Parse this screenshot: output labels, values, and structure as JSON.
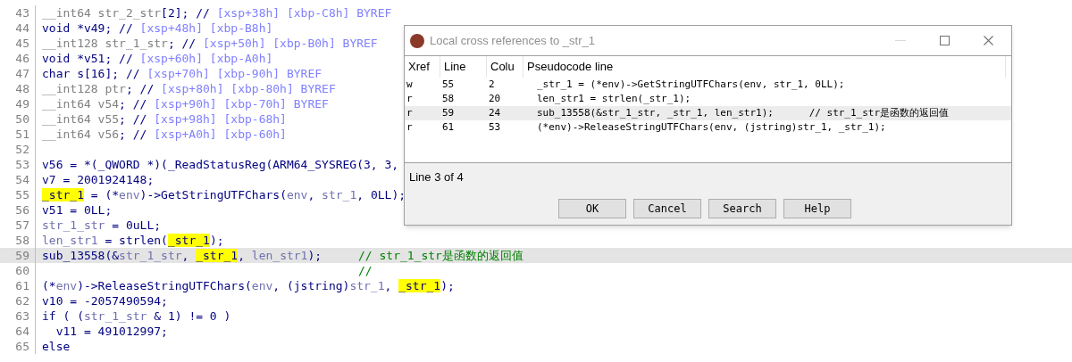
{
  "code_lines": [
    {
      "number": "43",
      "selected": false,
      "segments": [
        {
          "kind": "dim",
          "text": "__int64 str_2_str"
        },
        {
          "kind": "code",
          "text": "[2]; // "
        },
        {
          "kind": "cmt",
          "text": "[xsp+38h] [xbp-C8h] BYREF"
        }
      ]
    },
    {
      "number": "44",
      "selected": false,
      "segments": [
        {
          "kind": "code",
          "text": "void *v49; // "
        },
        {
          "kind": "cmt",
          "text": "[xsp+48h] [xbp-B8h]"
        }
      ]
    },
    {
      "number": "45",
      "selected": false,
      "segments": [
        {
          "kind": "dim",
          "text": "__int128 str_1_str"
        },
        {
          "kind": "code",
          "text": "; // "
        },
        {
          "kind": "cmt",
          "text": "[xsp+50h] [xbp-B0h] BYREF"
        }
      ]
    },
    {
      "number": "46",
      "selected": false,
      "segments": [
        {
          "kind": "code",
          "text": "void *v51; // "
        },
        {
          "kind": "cmt",
          "text": "[xsp+60h] [xbp-A0h]"
        }
      ]
    },
    {
      "number": "47",
      "selected": false,
      "segments": [
        {
          "kind": "code",
          "text": "char s[16]; // "
        },
        {
          "kind": "cmt",
          "text": "[xsp+70h] [xbp-90h] BYREF"
        }
      ]
    },
    {
      "number": "48",
      "selected": false,
      "segments": [
        {
          "kind": "dim",
          "text": "__int128 ptr"
        },
        {
          "kind": "code",
          "text": "; // "
        },
        {
          "kind": "cmt",
          "text": "[xsp+80h] [xbp-80h] BYREF"
        }
      ]
    },
    {
      "number": "49",
      "selected": false,
      "segments": [
        {
          "kind": "dim",
          "text": "__int64 v54"
        },
        {
          "kind": "code",
          "text": "; // "
        },
        {
          "kind": "cmt",
          "text": "[xsp+90h] [xbp-70h] BYREF"
        }
      ]
    },
    {
      "number": "50",
      "selected": false,
      "segments": [
        {
          "kind": "dim",
          "text": "__int64 v55"
        },
        {
          "kind": "code",
          "text": "; // "
        },
        {
          "kind": "cmt",
          "text": "[xsp+98h] [xbp-68h]"
        }
      ]
    },
    {
      "number": "51",
      "selected": false,
      "segments": [
        {
          "kind": "dim",
          "text": "__int64 v56"
        },
        {
          "kind": "code",
          "text": "; // "
        },
        {
          "kind": "cmt",
          "text": "[xsp+A0h] [xbp-60h]"
        }
      ]
    },
    {
      "number": "52",
      "selected": false
    },
    {
      "number": "53",
      "selected": false,
      "segments": [
        {
          "kind": "code",
          "text": "v56 = *(_QWORD *)(_ReadStatusReg(ARM64_SYSREG(3, 3,"
        }
      ]
    },
    {
      "number": "54",
      "selected": false,
      "segments": [
        {
          "kind": "code",
          "text": "v7 = 2001924148;"
        }
      ]
    },
    {
      "number": "55",
      "selected": false,
      "segments": [
        {
          "kind": "hl",
          "text": "_str_1"
        },
        {
          "kind": "code",
          "text": " = (*"
        },
        {
          "kind": "var",
          "text": "env"
        },
        {
          "kind": "code",
          "text": ")->GetStringUTFChars("
        },
        {
          "kind": "var",
          "text": "env"
        },
        {
          "kind": "code",
          "text": ", "
        },
        {
          "kind": "var",
          "text": "str_1"
        },
        {
          "kind": "code",
          "text": ", 0LL);"
        }
      ]
    },
    {
      "number": "56",
      "selected": false,
      "segments": [
        {
          "kind": "code",
          "text": "v51 = 0LL;"
        }
      ]
    },
    {
      "number": "57",
      "selected": false,
      "segments": [
        {
          "kind": "var",
          "text": "str_1_str"
        },
        {
          "kind": "code",
          "text": " = 0uLL;"
        }
      ]
    },
    {
      "number": "58",
      "selected": false,
      "segments": [
        {
          "kind": "var",
          "text": "len_str1"
        },
        {
          "kind": "code",
          "text": " = strlen("
        },
        {
          "kind": "hl",
          "text": "_str_1"
        },
        {
          "kind": "code",
          "text": ");"
        }
      ]
    },
    {
      "number": "59",
      "selected": true,
      "segments": [
        {
          "kind": "code",
          "text": "sub_13558(&"
        },
        {
          "kind": "var",
          "text": "str_1_str"
        },
        {
          "kind": "code",
          "text": ", "
        },
        {
          "kind": "hl",
          "text": "_str_1"
        },
        {
          "kind": "code",
          "text": ", "
        },
        {
          "kind": "var",
          "text": "len_str1"
        },
        {
          "kind": "code",
          "text": ");"
        }
      ],
      "note": "// str_1_str是函数的返回值"
    },
    {
      "number": "60",
      "selected": false,
      "note": "//"
    },
    {
      "number": "61",
      "selected": false,
      "segments": [
        {
          "kind": "code",
          "text": "(*"
        },
        {
          "kind": "var",
          "text": "env"
        },
        {
          "kind": "code",
          "text": ")->ReleaseStringUTFChars("
        },
        {
          "kind": "var",
          "text": "env"
        },
        {
          "kind": "code",
          "text": ", (jstring)"
        },
        {
          "kind": "var",
          "text": "str_1"
        },
        {
          "kind": "code",
          "text": ", "
        },
        {
          "kind": "hl",
          "text": "_str_1"
        },
        {
          "kind": "code",
          "text": ");"
        }
      ]
    },
    {
      "number": "62",
      "selected": false,
      "segments": [
        {
          "kind": "code",
          "text": "v10 = -2057490594;"
        }
      ]
    },
    {
      "number": "63",
      "selected": false,
      "segments": [
        {
          "kind": "code",
          "text": "if ( ("
        },
        {
          "kind": "var",
          "text": "str_1_str"
        },
        {
          "kind": "code",
          "text": " & 1) != 0 )"
        }
      ]
    },
    {
      "number": "64",
      "selected": false,
      "segments": [
        {
          "kind": "code",
          "text": "  v11 = 491012997;"
        }
      ]
    },
    {
      "number": "65",
      "selected": false,
      "segments": [
        {
          "kind": "code",
          "text": "else"
        }
      ]
    }
  ],
  "dialog": {
    "title": "Local cross references to _str_1",
    "columns": [
      "Xref",
      "Line",
      "Colu",
      "Pseudocode line"
    ],
    "rows": [
      {
        "xref": "w",
        "line": "55",
        "column": "2",
        "pseudocode": "_str_1 = (*env)->GetStringUTFChars(env, str_1, 0LL);",
        "selected": false
      },
      {
        "xref": "r",
        "line": "58",
        "column": "20",
        "pseudocode": "len_str1 = strlen(_str_1);",
        "selected": false
      },
      {
        "xref": "r",
        "line": "59",
        "column": "24",
        "pseudocode": "sub_13558(&str_1_str, _str_1, len_str1);      // str_1_str是函数的返回值",
        "selected": true
      },
      {
        "xref": "r",
        "line": "61",
        "column": "53",
        "pseudocode": "(*env)->ReleaseStringUTFChars(env, (jstring)str_1, _str_1);",
        "selected": false
      }
    ],
    "status": "Line 3 of 4",
    "buttons": [
      "OK",
      "Cancel",
      "Search",
      "Help"
    ]
  }
}
